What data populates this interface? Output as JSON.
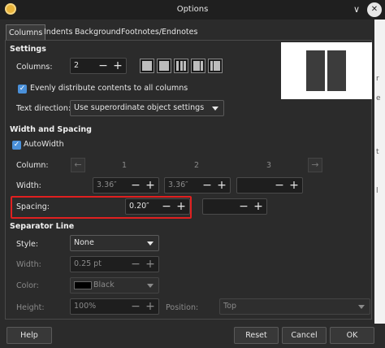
{
  "window": {
    "title": "Options"
  },
  "tabs": [
    "Columns",
    "Indents",
    "Background",
    "Footnotes/Endnotes"
  ],
  "settings": {
    "heading": "Settings",
    "columns_label": "Columns:",
    "columns_value": "2",
    "evenly_label": "Evenly distribute contents to all columns",
    "text_direction_label": "Text direction:",
    "text_direction_value": "Use superordinate object settings"
  },
  "width_spacing": {
    "heading": "Width and Spacing",
    "autowidth_label": "AutoWidth",
    "column_label": "Column:",
    "col_numbers": [
      "1",
      "2",
      "3"
    ],
    "width_label": "Width:",
    "width_values": [
      "3.36″",
      "3.36″",
      ""
    ],
    "spacing_label": "Spacing:",
    "spacing_values": [
      "0.20″",
      ""
    ]
  },
  "separator": {
    "heading": "Separator Line",
    "style_label": "Style:",
    "style_value": "None",
    "width_label": "Width:",
    "width_value": "0.25 pt",
    "color_label": "Color:",
    "color_value": "Black",
    "color_swatch": "#000000",
    "height_label": "Height:",
    "height_value": "100%",
    "position_label": "Position:",
    "position_value": "Top"
  },
  "buttons": {
    "help": "Help",
    "reset": "Reset",
    "cancel": "Cancel",
    "ok": "OK"
  },
  "glyphs": {
    "minus": "−",
    "plus": "+",
    "check": "✓",
    "left": "←",
    "right": "→",
    "collapse": "∨",
    "close": "✕"
  },
  "colors": {
    "highlight": "#e02020",
    "accent": "#4a90d9"
  }
}
